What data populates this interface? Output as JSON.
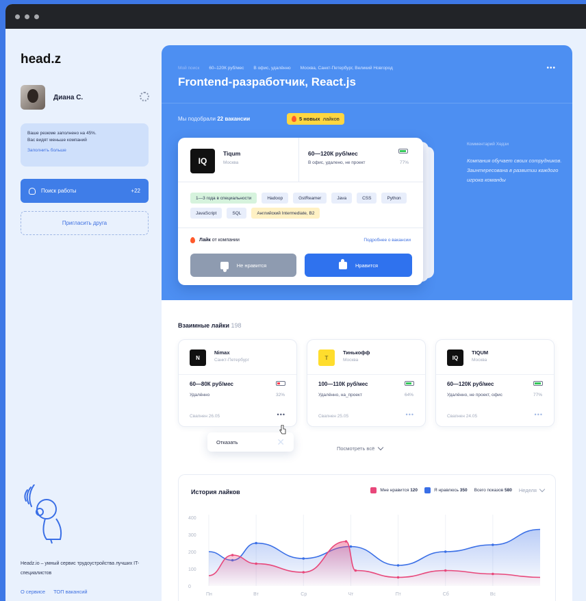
{
  "sidebar": {
    "logo": "head.z",
    "user_name": "Диана С.",
    "resume": {
      "line1": "Ваше резюме заполнено на 45%.",
      "line2": "Вас видят меньше компаний",
      "link": "Заполнить больше"
    },
    "search_label": "Поиск работы",
    "search_count": "+22",
    "invite_label": "Пригласить друга",
    "footer_text": "Headz.io – умный сервис трудоустройства лучших IT-специалистов",
    "links": [
      "О сервисе",
      "ТОП вакансий"
    ]
  },
  "hero": {
    "breadcrumbs": [
      "Мой поиск",
      "60–120К руб/мес",
      "В офис, удалённо",
      "Москва, Санкт-Петербург, Великий Новгород"
    ],
    "title": "Frontend-разработчик, React.js",
    "matched_prefix": "Мы подобрали",
    "matched_count": "22 вакансии",
    "new_likes_count": "5 новых",
    "new_likes_suffix": "лайков",
    "comment_title": "Комментарий Хедзи",
    "comment_text": "Компания обучает своих сотрудников. Заинтересована в развитии каждого игрока команды"
  },
  "job_card": {
    "logo_text": "IQ",
    "company": "Tiqum",
    "city": "Москва",
    "salary": "60—120К руб/мес",
    "format": "В офис, удалено, не проект",
    "match": "77%",
    "match_fraction": 0.77,
    "tags": [
      {
        "label": "1—3 года в специальности",
        "kind": "green"
      },
      {
        "label": "Hadoop",
        "kind": "default"
      },
      {
        "label": "GstReamer",
        "kind": "default"
      },
      {
        "label": "Java",
        "kind": "default"
      },
      {
        "label": "CSS",
        "kind": "default"
      },
      {
        "label": "Python",
        "kind": "default"
      },
      {
        "label": "JavaScript",
        "kind": "default"
      },
      {
        "label": "SQL",
        "kind": "default"
      },
      {
        "label": "Английский Intermediate, B2",
        "kind": "yellow"
      }
    ],
    "liked_bold": "Лайк",
    "liked_rest": "от компании",
    "details_link": "Подробнее о вакансии",
    "dislike_label": "Не нравится",
    "like_label": "Нравится"
  },
  "mutual": {
    "title": "Взаимные лайки",
    "count": "198",
    "cards": [
      {
        "logo": "N",
        "logo_color": "#111111",
        "name": "Nimax",
        "city": "Санкт-Петербург",
        "salary": "60—80К руб/мес",
        "format": "Удалённо",
        "match": "32%",
        "match_fraction": 0.32,
        "status": "red",
        "date": "Свапнен 26.05"
      },
      {
        "logo": "Т",
        "logo_color": "#ffdd2d",
        "name": "Тинькофф",
        "city": "Москва",
        "salary": "100—110К руб/мес",
        "format": "Удалённо, на_проект",
        "match": "64%",
        "match_fraction": 0.64,
        "status": "green",
        "date": "Свапнен 25.05"
      },
      {
        "logo": "IQ",
        "logo_color": "#111111",
        "name": "TIQUM",
        "city": "Москва",
        "salary": "60—120К руб/мес",
        "format": "Удалённо, не проект, офис",
        "match": "77%",
        "match_fraction": 0.77,
        "status": "green",
        "date": "Свапнен 24.05"
      }
    ],
    "refuse_label": "Отказать",
    "see_all": "Посмотреть всё"
  },
  "history": {
    "title": "История лайков",
    "legend": [
      {
        "label": "Мне нравится",
        "value": "120",
        "color": "#e8477a"
      },
      {
        "label": "Я нравлюсь",
        "value": "350",
        "color": "#3a6fe6"
      },
      {
        "label": "Всего показов",
        "value": "580",
        "color": ""
      }
    ],
    "period": "Неделя"
  },
  "chart_data": {
    "type": "area",
    "x": [
      "Пн",
      "Вт",
      "Ср",
      "Чт",
      "Пт",
      "Сб",
      "Вс"
    ],
    "y_ticks": [
      400,
      300,
      200,
      100,
      0
    ],
    "ylim": [
      0,
      400
    ],
    "series": [
      {
        "name": "Я нравлюсь",
        "color": "#3a6fe6",
        "points": [
          [
            0,
            200
          ],
          [
            0.5,
            150
          ],
          [
            1,
            250
          ],
          [
            2,
            160
          ],
          [
            3,
            230
          ],
          [
            4,
            120
          ],
          [
            5,
            200
          ],
          [
            6,
            240
          ],
          [
            7,
            330
          ]
        ]
      },
      {
        "name": "Мне нравится",
        "color": "#e8477a",
        "points": [
          [
            0,
            60
          ],
          [
            0.5,
            180
          ],
          [
            1,
            130
          ],
          [
            2,
            80
          ],
          [
            2.9,
            260
          ],
          [
            3.1,
            90
          ],
          [
            4,
            50
          ],
          [
            5,
            90
          ],
          [
            6,
            70
          ],
          [
            7,
            50
          ]
        ]
      }
    ]
  }
}
